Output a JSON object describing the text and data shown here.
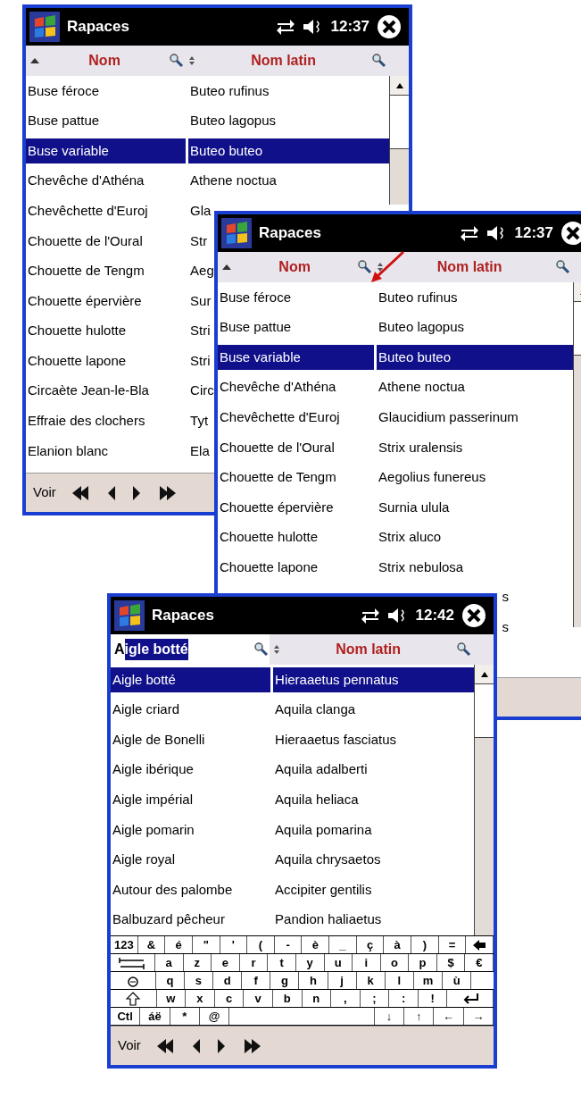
{
  "windows": [
    {
      "title": "Rapaces",
      "time": "12:37",
      "header": {
        "name_label": "Nom",
        "latin_label": "Nom latin"
      },
      "rows": [
        {
          "nom": "Buse féroce",
          "latin": "Buteo rufinus",
          "selected": false
        },
        {
          "nom": "Buse pattue",
          "latin": "Buteo lagopus",
          "selected": false
        },
        {
          "nom": "Buse variable",
          "latin": "Buteo buteo",
          "selected": true
        },
        {
          "nom": "Chevêche d'Athéna",
          "latin": "Athene noctua",
          "selected": false
        },
        {
          "nom": "Chevêchette d'Euroj",
          "latin": "Gla",
          "selected": false
        },
        {
          "nom": "Chouette de l'Oural",
          "latin": "Str",
          "selected": false
        },
        {
          "nom": "Chouette de Tengm",
          "latin": "Aeg",
          "selected": false
        },
        {
          "nom": "Chouette épervière",
          "latin": "Sur",
          "selected": false
        },
        {
          "nom": "Chouette hulotte",
          "latin": "Stri",
          "selected": false
        },
        {
          "nom": "Chouette lapone",
          "latin": "Stri",
          "selected": false
        },
        {
          "nom": "Circaète Jean-le-Bla",
          "latin": "Circ",
          "selected": false
        },
        {
          "nom": "Effraie des clochers",
          "latin": "Tyt",
          "selected": false
        },
        {
          "nom": "Elanion blanc",
          "latin": "Ela",
          "selected": false
        }
      ],
      "footer": {
        "label": "Voir"
      }
    },
    {
      "title": "Rapaces",
      "time": "12:37",
      "header": {
        "name_label": "Nom",
        "latin_label": "Nom latin"
      },
      "rows": [
        {
          "nom": "Buse féroce",
          "latin": "Buteo rufinus",
          "selected": false
        },
        {
          "nom": "Buse pattue",
          "latin": "Buteo lagopus",
          "selected": false
        },
        {
          "nom": "Buse variable",
          "latin": "Buteo buteo",
          "selected": true
        },
        {
          "nom": "Chevêche d'Athéna",
          "latin": "Athene noctua",
          "selected": false
        },
        {
          "nom": "Chevêchette d'Euroj",
          "latin": "Glaucidium passerinum",
          "selected": false
        },
        {
          "nom": "Chouette de l'Oural",
          "latin": "Strix uralensis",
          "selected": false
        },
        {
          "nom": "Chouette de Tengm",
          "latin": "Aegolius funereus",
          "selected": false
        },
        {
          "nom": "Chouette épervière",
          "latin": "Surnia ulula",
          "selected": false
        },
        {
          "nom": "Chouette hulotte",
          "latin": "Strix aluco",
          "selected": false
        },
        {
          "nom": "Chouette lapone",
          "latin": "Strix nebulosa",
          "selected": false
        }
      ],
      "fragments": [
        "s",
        "s"
      ]
    },
    {
      "title": "Rapaces",
      "time": "12:42",
      "header": {
        "search_field": {
          "typed": "A",
          "completion": "igle botté"
        },
        "latin_label": "Nom latin"
      },
      "rows": [
        {
          "nom": "Aigle botté",
          "latin": "Hieraaetus pennatus",
          "selected": true
        },
        {
          "nom": "Aigle criard",
          "latin": "Aquila clanga",
          "selected": false
        },
        {
          "nom": "Aigle de Bonelli",
          "latin": "Hieraaetus fasciatus",
          "selected": false
        },
        {
          "nom": "Aigle ibérique",
          "latin": "Aquila adalberti",
          "selected": false
        },
        {
          "nom": "Aigle impérial",
          "latin": "Aquila heliaca",
          "selected": false
        },
        {
          "nom": "Aigle pomarin",
          "latin": "Aquila pomarina",
          "selected": false
        },
        {
          "nom": "Aigle royal",
          "latin": "Aquila chrysaetos",
          "selected": false
        },
        {
          "nom": "Autour des palombe",
          "latin": "Accipiter gentilis",
          "selected": false
        },
        {
          "nom": "Balbuzard pêcheur",
          "latin": "Pandion haliaetus",
          "selected": false
        }
      ],
      "keyboard": [
        [
          {
            "kind": "char",
            "label": "123"
          },
          {
            "kind": "char",
            "label": "&"
          },
          {
            "kind": "char",
            "label": "é"
          },
          {
            "kind": "char",
            "label": "\""
          },
          {
            "kind": "char",
            "label": "'"
          },
          {
            "kind": "char",
            "label": "("
          },
          {
            "kind": "char",
            "label": "-"
          },
          {
            "kind": "char",
            "label": "è"
          },
          {
            "kind": "char",
            "label": "_"
          },
          {
            "kind": "char",
            "label": "ç"
          },
          {
            "kind": "char",
            "label": "à"
          },
          {
            "kind": "char",
            "label": ")"
          },
          {
            "kind": "char",
            "label": "="
          },
          {
            "kind": "backspace"
          }
        ],
        [
          {
            "kind": "tab"
          },
          {
            "kind": "char",
            "label": "a"
          },
          {
            "kind": "char",
            "label": "z"
          },
          {
            "kind": "char",
            "label": "e"
          },
          {
            "kind": "char",
            "label": "r"
          },
          {
            "kind": "char",
            "label": "t"
          },
          {
            "kind": "char",
            "label": "y"
          },
          {
            "kind": "char",
            "label": "u"
          },
          {
            "kind": "char",
            "label": "i"
          },
          {
            "kind": "char",
            "label": "o"
          },
          {
            "kind": "char",
            "label": "p"
          },
          {
            "kind": "char",
            "label": "$"
          },
          {
            "kind": "char",
            "label": "€"
          }
        ],
        [
          {
            "kind": "caps"
          },
          {
            "kind": "char",
            "label": "q"
          },
          {
            "kind": "char",
            "label": "s"
          },
          {
            "kind": "char",
            "label": "d"
          },
          {
            "kind": "char",
            "label": "f"
          },
          {
            "kind": "char",
            "label": "g"
          },
          {
            "kind": "char",
            "label": "h"
          },
          {
            "kind": "char",
            "label": "j"
          },
          {
            "kind": "char",
            "label": "k"
          },
          {
            "kind": "char",
            "label": "l"
          },
          {
            "kind": "char",
            "label": "m"
          },
          {
            "kind": "char",
            "label": "ù"
          },
          {
            "kind": "gap"
          }
        ],
        [
          {
            "kind": "shift"
          },
          {
            "kind": "char",
            "label": "w"
          },
          {
            "kind": "char",
            "label": "x"
          },
          {
            "kind": "char",
            "label": "c"
          },
          {
            "kind": "char",
            "label": "v"
          },
          {
            "kind": "char",
            "label": "b"
          },
          {
            "kind": "char",
            "label": "n"
          },
          {
            "kind": "char",
            "label": ","
          },
          {
            "kind": "char",
            "label": ";"
          },
          {
            "kind": "char",
            "label": ":"
          },
          {
            "kind": "char",
            "label": "!"
          },
          {
            "kind": "enter"
          }
        ],
        [
          {
            "kind": "char",
            "label": "Ctl"
          },
          {
            "kind": "char",
            "label": "áë"
          },
          {
            "kind": "char",
            "label": "*"
          },
          {
            "kind": "char",
            "label": "@"
          },
          {
            "kind": "space"
          },
          {
            "kind": "char",
            "label": "↓"
          },
          {
            "kind": "char",
            "label": "↑"
          },
          {
            "kind": "char",
            "label": "←"
          },
          {
            "kind": "char",
            "label": "→"
          }
        ]
      ],
      "footer": {
        "label": "Voir"
      }
    }
  ]
}
